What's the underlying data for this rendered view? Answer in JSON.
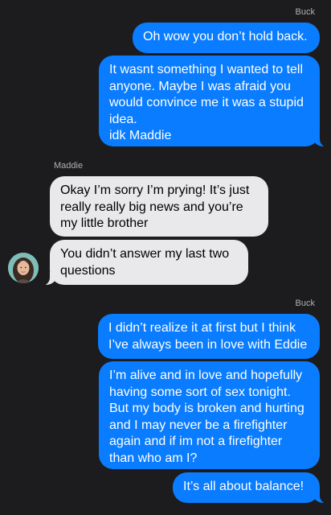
{
  "conversation": {
    "sender_buck_1": "Buck",
    "sender_maddie": "Maddie",
    "sender_buck_2": "Buck",
    "avatar": {
      "icon": "contact-avatar-photo",
      "name": "Maddie"
    },
    "messages": [
      {
        "from": "Buck",
        "text": "Oh wow you don’t hold back."
      },
      {
        "from": "Buck",
        "text": "It wasnt something I wanted to tell anyone. Maybe I was afraid you would convince me it was a stupid idea.\nidk Maddie"
      },
      {
        "from": "Maddie",
        "text": "Okay I’m sorry I’m prying! It’s just really really big news and you’re my little brother"
      },
      {
        "from": "Maddie",
        "text": "You didn’t answer my last two questions"
      },
      {
        "from": "Buck",
        "text": "I didn’t realize it at first but I think I’ve always been in love with Eddie"
      },
      {
        "from": "Buck",
        "text": "I’m alive and in love and hopefully having some sort of sex tonight. But my body is broken and hurting and I may never be a firefighter again and if im not a firefighter than who am I?"
      },
      {
        "from": "Buck",
        "text": "It’s all about balance!"
      }
    ]
  },
  "colors": {
    "background": "#1c1c1e",
    "outgoing_bubble": "#0a7cff",
    "incoming_bubble": "#e9e9eb"
  }
}
